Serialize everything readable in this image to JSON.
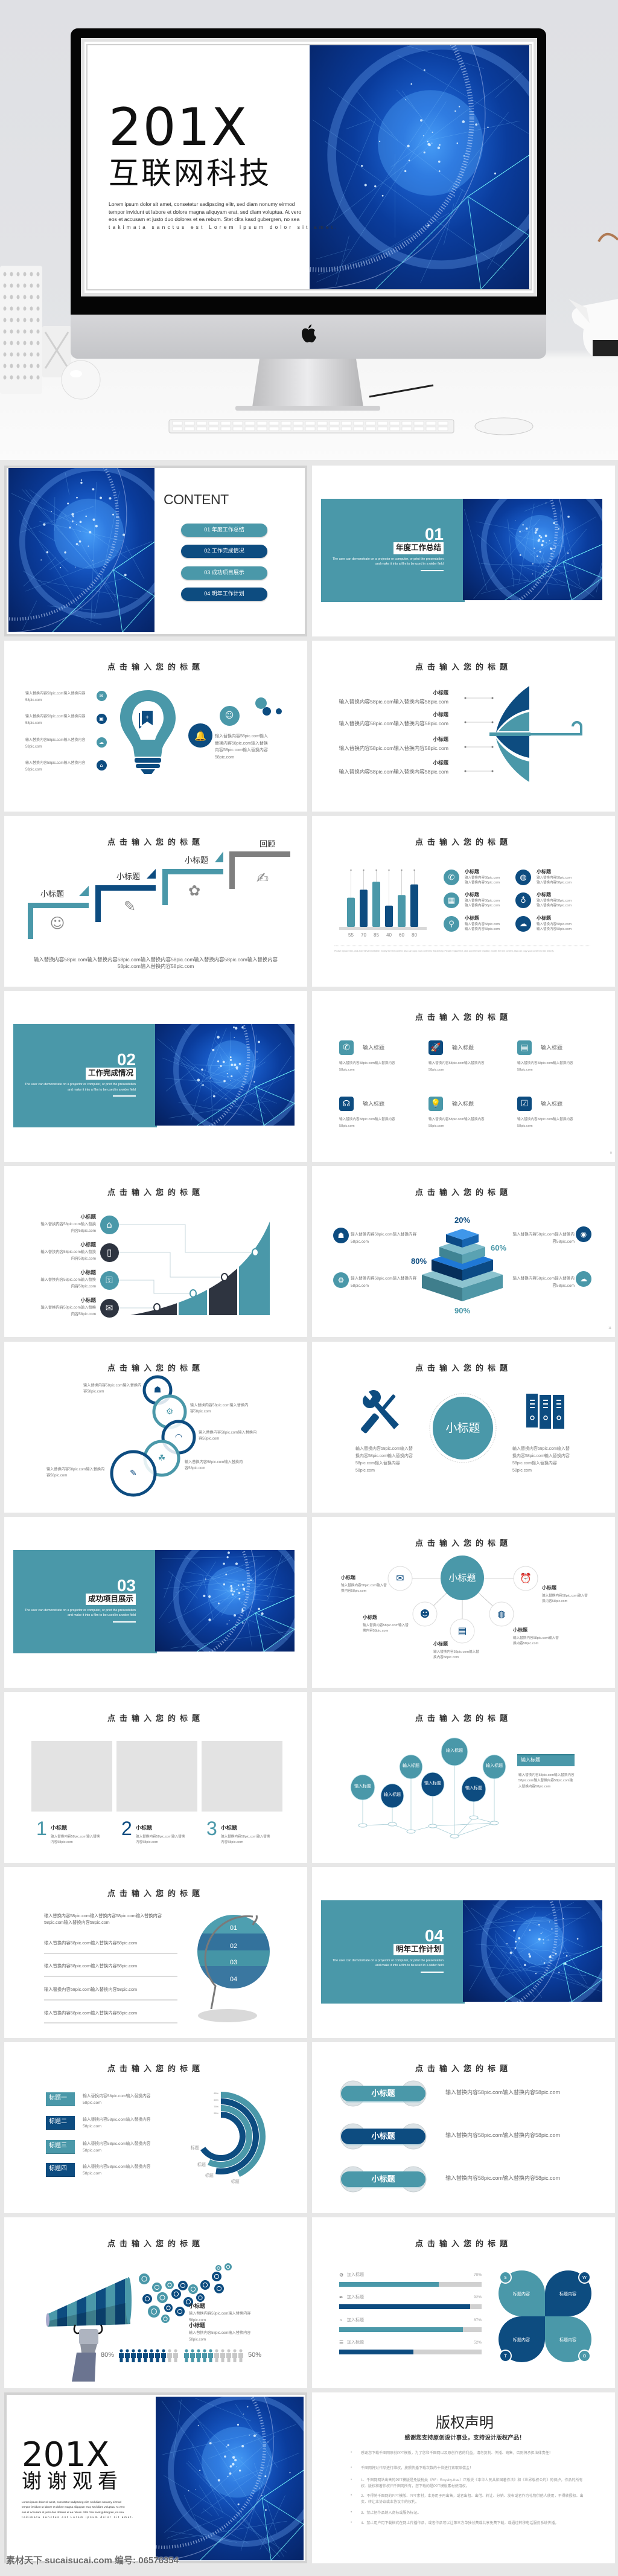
{
  "colors": {
    "teal": "#4a98a9",
    "navy": "#0d4c80",
    "dark": "#2e3440",
    "gray": "#d9d9d9",
    "track": "#d0d0d0"
  },
  "hero": {
    "year": "201X",
    "title": "互联网科技",
    "lorem": [
      "Lorem ipsum dolor sit amet, consetetur sadipscing elitr, sed diam nonumy eirmod",
      "tempor invidunt ut labore et dolore magna aliquyam erat, sed diam voluptua. At vero",
      "eos et accusam et justo duo dolores et ea rebum. Stet clita kasd gubergren, no sea",
      "takimata sanctus est Lorem ipsum dolor sit amet."
    ]
  },
  "common": {
    "slide_title": "点击输入您的标题",
    "subtitle": "小标题",
    "input_title": "输入标题",
    "body_one": "输入替换内容58pic.com",
    "body_two": "输入替换内容58pic.com输入替换内容58pic.com",
    "body_long": "输入替换内容58pic.com输入替换内容58pic.com输入替换内容58pic.com输入替换内容58pic.com",
    "section_en": "The user can demonstrate on a projector or computer, or print the presentation and make it into a film to be used in a wider field"
  },
  "contents": {
    "heading": "CONTENT",
    "items": [
      "01.年度工作总结",
      "02.工作完成情况",
      "03.成功项目展示",
      "04.明年工作计划"
    ]
  },
  "sections": [
    {
      "num": "01",
      "label": "年度工作总结"
    },
    {
      "num": "02",
      "label": "工作完成情况"
    },
    {
      "num": "03",
      "label": "成功项目展示"
    },
    {
      "num": "04",
      "label": "明年工作计划"
    }
  ],
  "stairs": {
    "review": "回顾",
    "bottom": "输入替换内容58pic.com输入替换内容58pic.com输入替换内容58pic.com输入替换内容58pic.com输入替换内容58pic.com输入替换内容58pic.com"
  },
  "chart_data": {
    "type": "bar",
    "categories": [
      "55",
      "70",
      "85",
      "40",
      "60",
      "80"
    ],
    "values": [
      55,
      70,
      85,
      40,
      60,
      80
    ],
    "title": "",
    "xlabel": "",
    "ylabel": "",
    "ylim": [
      0,
      100
    ],
    "grid": false,
    "bar_colors": [
      "#4a98a9",
      "#0d4c80",
      "#4a98a9",
      "#0d4c80",
      "#4a98a9",
      "#0d4c80"
    ],
    "footer": "Please replace text, click add relevant headline, modify the text content, also can copy your content to this directly. Please replace text, click add relevant headline, modify the text content, also can copy your content to this directly."
  },
  "chart_icons": [
    "phone-icon",
    "globe-icon",
    "calendar-icon",
    "bulb-icon",
    "location-icon",
    "cloud-download-icon"
  ],
  "page_numbers": {
    "icons_slide": "9",
    "pyramid_slide": "11"
  },
  "pyramid": {
    "labels": [
      "20%",
      "60%",
      "80%",
      "90%"
    ]
  },
  "arcs": {
    "labels": [
      "标题一",
      "标题二",
      "标题三",
      "标题四"
    ],
    "percents": [
      "85%",
      "63%",
      "78%",
      "55%"
    ],
    "end_label": "标题"
  },
  "megaphone": {
    "left_pct": "80%",
    "right_pct": "50%"
  },
  "progress": {
    "label": "加入标题",
    "items": [
      {
        "pct": "70%",
        "value": 70,
        "icon": "gear-icon"
      },
      {
        "pct": "92%",
        "value": 92,
        "icon": "pen-icon"
      },
      {
        "pct": "87%",
        "value": 87,
        "icon": "pie-chart-icon"
      },
      {
        "pct": "52%",
        "value": 52,
        "icon": "list-icon"
      }
    ]
  },
  "swot": {
    "letters": [
      "S",
      "W",
      "T",
      "O"
    ],
    "content": "标题内容"
  },
  "thanks": {
    "year": "201X",
    "title": "谢谢观看"
  },
  "copyright": {
    "title": "版权声明",
    "subtitle": "感谢您支持原创设计事业，支持设计版权产品！",
    "bullets": [
      "感谢您下载千图网原创PPT模板，为了您和千图网以及原创作者的利益，请勿复制、传播、销售，否则将承担法律责任！",
      "千图网将对作品进行维权，按照传播下载次数的十倍进行索取赔偿金！",
      "1、千图网网站出售的PPT模版是免版税类（RF：Royalty-free）正版受《中华人民共和国著作法》和《世界版权公约》的保护，作品的所有权、版权和著作权归千图网所有，您下载的是PPT模版素材使用权。",
      "2、不得将千图网的PPT模版、PPT素材，本身用于再出售，或者出租、出借、转让、分销、发布或者作为礼物供他人使用，不得转授权、出卖、转让本协议或本协议中的权利。",
      "3、禁止把作品纳入商标或服务标记。",
      "4、禁止用户用下载格式在网上传播作品，或者作品可以让第三方单独付费或共享免费下载，或通过转移电话服务系统传播。"
    ]
  },
  "watermark": "素材天下 sucaisucai.com 编号: 06576354"
}
